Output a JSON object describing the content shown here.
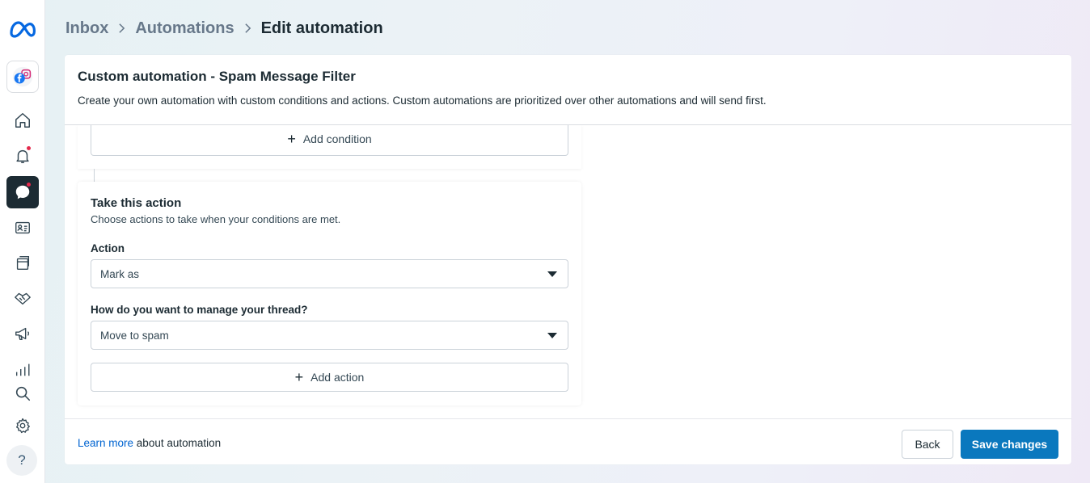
{
  "sidebar": {
    "logo_icon": "meta-logo-icon",
    "account_icon": "facebook-instagram-accounts-icon",
    "items": [
      {
        "icon": "home-icon",
        "active": false,
        "notification": false
      },
      {
        "icon": "bell-icon",
        "active": false,
        "notification": true
      },
      {
        "icon": "inbox-chat-icon",
        "active": true,
        "notification": true
      },
      {
        "icon": "contact-card-icon",
        "active": false,
        "notification": false
      },
      {
        "icon": "content-pages-icon",
        "active": false,
        "notification": false
      },
      {
        "icon": "handshake-icon",
        "active": false,
        "notification": false
      },
      {
        "icon": "megaphone-icon",
        "active": false,
        "notification": false
      },
      {
        "icon": "bar-chart-icon",
        "active": false,
        "notification": false
      },
      {
        "icon": "search-icon",
        "active": false,
        "notification": false
      },
      {
        "icon": "gear-icon",
        "active": false,
        "notification": false
      }
    ],
    "help_label": "?"
  },
  "breadcrumb": {
    "items": [
      "Inbox",
      "Automations"
    ],
    "current": "Edit automation"
  },
  "card": {
    "title": "Custom automation - Spam Message Filter",
    "description": "Create your own automation with custom conditions and actions. Custom automations are prioritized over other automations and will send first.",
    "add_condition_label": "Add condition",
    "action_section": {
      "title": "Take this action",
      "subtitle": "Choose actions to take when your conditions are met.",
      "action_label": "Action",
      "action_value": "Mark as",
      "thread_label": "How do you want to manage your thread?",
      "thread_value": "Move to spam",
      "add_action_label": "Add action"
    },
    "footer": {
      "learn_more_link": "Learn more",
      "learn_more_suffix": " about automation",
      "back_label": "Back",
      "save_label": "Save changes"
    }
  },
  "colors": {
    "primary": "#0a78be",
    "link": "#0064d1",
    "active_sidebar": "#1c2b33",
    "notification": "#e4294c"
  }
}
